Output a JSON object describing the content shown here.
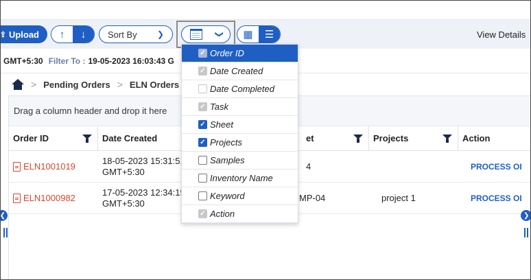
{
  "toolbar": {
    "upload_label": "Upload",
    "sort_asc_glyph": "↑",
    "sort_desc_glyph": "↓",
    "sort_by_label": "Sort By",
    "view_details_label": "View Details"
  },
  "filter_bar": {
    "tz_text": "GMT+5:30",
    "filter_label": "Filter To :",
    "filter_value": "19-05-2023 16:03:43 G"
  },
  "breadcrumb": {
    "items": [
      "Pending Orders",
      "ELN Orders"
    ]
  },
  "grid": {
    "group_hint": "Drag a column header and drop it here",
    "columns": [
      "Order ID",
      "Date Created",
      "Sheet",
      "Projects",
      "Action"
    ],
    "sheet_visible": "et",
    "rows": [
      {
        "order_id": "ELN1001019",
        "date_line1": "18-05-2023 15:31:51",
        "date_line2": "GMT+5:30",
        "sheet": "4",
        "project": "",
        "action": "PROCESS OI"
      },
      {
        "order_id": "ELN1000982",
        "date_line1": "17-05-2023 12:34:15",
        "date_line2": "GMT+5:30",
        "sheet": "MP-04",
        "project": "project 1",
        "action": "PROCESS OI"
      }
    ]
  },
  "column_menu": {
    "items": [
      {
        "label": "Order ID",
        "state": "disabled-checked",
        "active": true
      },
      {
        "label": "Date Created",
        "state": "disabled-checked",
        "active": false
      },
      {
        "label": "Date Completed",
        "state": "disabled-unchecked",
        "active": false
      },
      {
        "label": "Task",
        "state": "disabled-checked",
        "active": false
      },
      {
        "label": "Sheet",
        "state": "checked",
        "active": false
      },
      {
        "label": "Projects",
        "state": "checked",
        "active": false
      },
      {
        "label": "Samples",
        "state": "unchecked",
        "active": false
      },
      {
        "label": "Inventory Name",
        "state": "unchecked",
        "active": false
      },
      {
        "label": "Keyword",
        "state": "unchecked",
        "active": false
      },
      {
        "label": "Action",
        "state": "disabled-checked",
        "active": false
      }
    ]
  },
  "colors": {
    "accent": "#1f5fc4",
    "order_link": "#d9462b",
    "filter_label": "#6a7fa8"
  }
}
